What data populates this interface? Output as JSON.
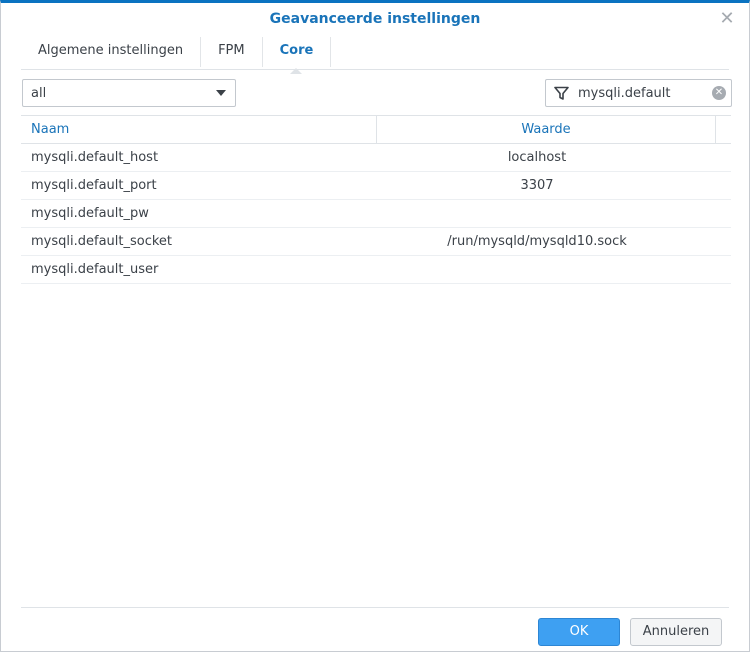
{
  "dialog": {
    "title": "Geavanceerde instellingen",
    "close_glyph": "✕"
  },
  "tabs": [
    {
      "label": "Algemene instellingen",
      "active": false
    },
    {
      "label": "FPM",
      "active": false
    },
    {
      "label": "Core",
      "active": true
    }
  ],
  "filter_select": {
    "value": "all"
  },
  "search": {
    "value": "mysqli.default",
    "icon": "funnel-icon"
  },
  "grid": {
    "headers": [
      "Naam",
      "Waarde"
    ],
    "rows": [
      {
        "name": "mysqli.default_host",
        "value": "localhost"
      },
      {
        "name": "mysqli.default_port",
        "value": "3307"
      },
      {
        "name": "mysqli.default_pw",
        "value": ""
      },
      {
        "name": "mysqli.default_socket",
        "value": "/run/mysqld/mysqld10.sock"
      },
      {
        "name": "mysqli.default_user",
        "value": ""
      }
    ]
  },
  "buttons": {
    "ok": "OK",
    "cancel": "Annuleren"
  },
  "colors": {
    "accent": "#1a74b9",
    "primary_button": "#3ea0f2"
  }
}
